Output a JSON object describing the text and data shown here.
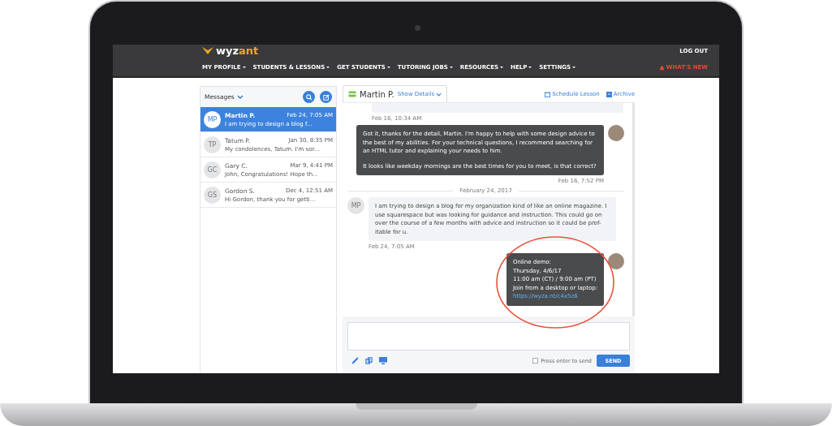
{
  "header": {
    "logo": "wyzant",
    "logout": "LOG OUT",
    "whats_new": "WHAT'S NEW",
    "menu": [
      {
        "label": "MY PROFILE"
      },
      {
        "label": "STUDENTS & LESSONS"
      },
      {
        "label": "GET STUDENTS"
      },
      {
        "label": "TUTORING JOBS"
      },
      {
        "label": "RESOURCES"
      },
      {
        "label": "HELP"
      },
      {
        "label": "SETTINGS"
      }
    ]
  },
  "inbox": {
    "title": "Messages",
    "conversations": [
      {
        "initials": "MP",
        "name": "Martin P.",
        "time": "Feb 24, 7:05 AM",
        "preview": "I am trying to design a blog f...",
        "selected": true
      },
      {
        "initials": "TP",
        "name": "Tatum P.",
        "time": "Jan 30, 8:35 PM",
        "preview": "My condolences, Tatum. I'm sor...",
        "selected": false
      },
      {
        "initials": "GC",
        "name": "Gary C.",
        "time": "Mar 9, 4:41 PM",
        "preview": "John, Congratulations! Hope th...",
        "selected": false
      },
      {
        "initials": "GS",
        "name": "Gordon S.",
        "time": "Dec 4, 12:51 AM",
        "preview": "Hi Gordon, thank you for getti...",
        "selected": false
      }
    ]
  },
  "chat": {
    "contact": "Martin P.",
    "show_details": "Show Details",
    "schedule": "Schedule Lesson",
    "archive": "Archive",
    "messages": [
      {
        "kind": "incoming",
        "time": "Feb 16, 10:34 AM"
      },
      {
        "kind": "outgoing",
        "lines": [
          "Got it, thanks for the detail, Martin. I'm happy to help with some design advice to the best of my abilities. For your technical questions, I recommend searching for an HTML tutor and explaining your needs to him.",
          "It looks like weekday mornings are the best times for you to meet, is that correct?"
        ],
        "time": "Feb 16, 7:52 PM"
      },
      {
        "kind": "divider",
        "text": "February 24, 2017"
      },
      {
        "kind": "incoming",
        "initials": "MP",
        "lines": [
          "I am trying to design a blog for my organization kind of like an online magazine. I use squarespace but was looking for guidance and instruction. This could go on over the course of a few months with advice and instruction so it could be prof-itable for u."
        ],
        "time": "Feb 24, 7:05 AM"
      },
      {
        "kind": "outgoing",
        "lines": [
          "Online demo:",
          "Thursday, 4/6/17",
          "11:00 am (CT) / 9:00 am (PT)",
          "Join from a desktop or laptop:"
        ],
        "link": "https://wyza.nt/c4x5z6",
        "highlighted": true
      }
    ],
    "compose": {
      "enter_label": "Press enter to send",
      "enter_checked": false,
      "send": "SEND"
    }
  }
}
